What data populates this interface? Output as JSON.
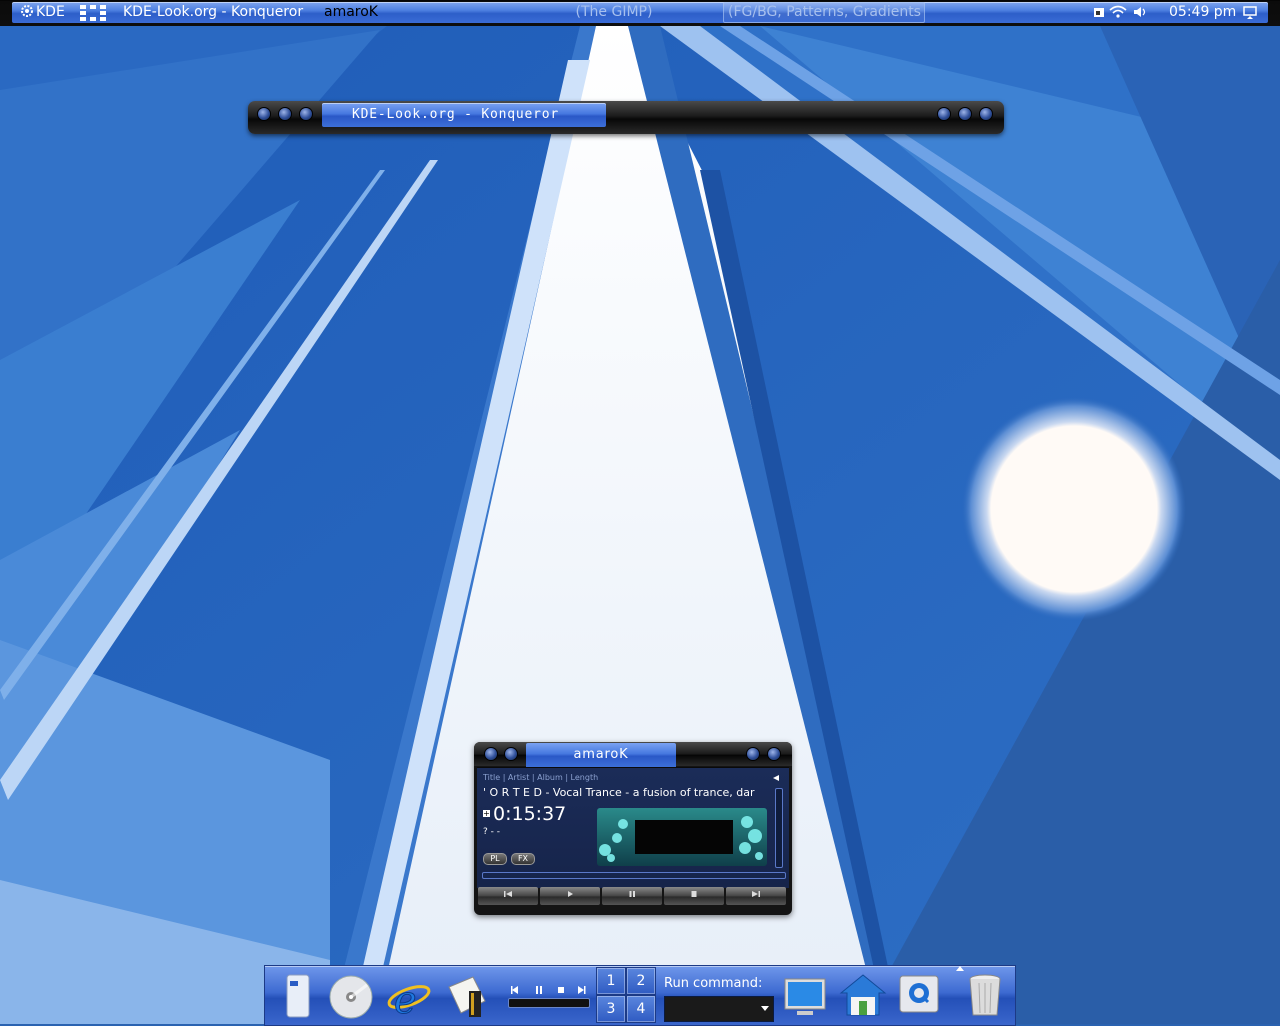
{
  "top_panel": {
    "kde_label": "KDE",
    "tasks": [
      {
        "label": "KDE-Look.org - Konqueror"
      },
      {
        "label": "amaroK"
      },
      {
        "label": "(The GIMP)"
      },
      {
        "label": "(FG/BG, Patterns, Gradients"
      }
    ],
    "clock": "05:49 pm"
  },
  "konqueror": {
    "title": "KDE-Look.org - Konqueror"
  },
  "amarok": {
    "title": "amaroK",
    "columns": "Title | Artist | Album | Length",
    "track_text": "' O R T E D - Vocal Trance - a fusion of trance, dar",
    "time": "0:15:37",
    "status": "? - -",
    "pl_label": "PL",
    "fx_label": "FX",
    "controls": [
      "prev",
      "play",
      "pause",
      "stop",
      "next"
    ]
  },
  "dock": {
    "pager": [
      "1",
      "2",
      "3",
      "4"
    ],
    "run_label": "Run command:",
    "icons": [
      "media-player-icon",
      "cd-icon",
      "internet-explorer-icon",
      "books-icon",
      "monitor-icon",
      "home-icon",
      "quicktime-icon",
      "trash-icon"
    ]
  },
  "colors": {
    "panel_blue": "#3d6ad1",
    "wallpaper_blue": "#2a62b0"
  }
}
